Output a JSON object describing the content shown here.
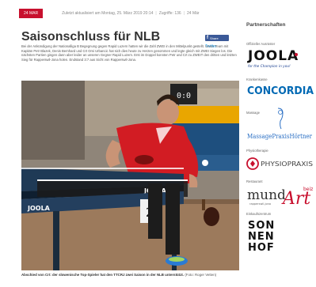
{
  "article": {
    "date_badge": "24 MAR",
    "updated": "Zuletzt aktualisiert am Montag, 25. März 2019 20:14",
    "hits": "Zugriffe: 136",
    "date_short": "24 Mär",
    "title": "Saisonschluss für NLB",
    "lead": "Bei der Ankündigung der Nationalliga B Begegnung gegen Rapid Luzern hatten wir die Zahl ZWEI in den Mittelpunkt gestellt. Unser Team mit Kapitän Petr Blazek, Denis Bernhard und Crt Omi Urbancic hat sich dies heute zu Herzen genommen und legte gleich mit ZWEI Siegen los. Die nächsten Partien gingen dann aber leider an unseren Gegner Rapid Luzern. Erst im Doppel konnten Petr und Crt zu ZWEIT den dritten und letzten Sieg für Rapperswil-Jona holen. Endstand 3:7 aus Sicht von Rapperswil-Jona.",
    "caption_bold": "Abschied von Crt: der slowenische Top-Spieler hat den TTCRJ zwei Saison in der NLB unterstützt.",
    "caption_credit": "(Foto: Roger Vetten)"
  },
  "share": {
    "facebook": "Share",
    "twitter": "Twitter"
  },
  "photo": {
    "scoreboard": "0:0",
    "table_brand": "JOOLA",
    "table_number": "2"
  },
  "sidebar": {
    "title": "Partnerschaften",
    "partners": [
      {
        "label": "Offizieller Ausrüster",
        "logo": "JOOLA",
        "tagline": "for the Champion in you!"
      },
      {
        "label": "Krankenkasse",
        "logo": "CONCORDIA"
      },
      {
        "label": "Massage",
        "logo": "MassagePraxisHörtner"
      },
      {
        "label": "Physiotherapie",
        "logo": "PHYSIOPRAXIS"
      },
      {
        "label": "Restaurant",
        "logo_a": "mund",
        "logo_b": "Art",
        "logo_c": "beiz",
        "logo_d": "rapperswil-jona"
      },
      {
        "label": "Einkaufszentrum",
        "logo_l1": "SON",
        "logo_l2": "NEN",
        "logo_l3": "HOF"
      }
    ]
  },
  "colors": {
    "brand_red": "#c8102e",
    "concordia_blue": "#0069b4",
    "joola_blue": "#1a3f8f",
    "joola_orange": "#f39200",
    "facebook": "#3b5998"
  }
}
